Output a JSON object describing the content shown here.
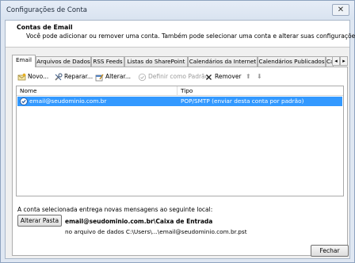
{
  "window": {
    "title": "Configurações de Conta",
    "close_glyph": "✕"
  },
  "header": {
    "title": "Contas de Email",
    "description": "Você pode adicionar ou remover uma conta. Também pode selecionar uma conta e alterar suas configurações."
  },
  "tabs": [
    {
      "label": "Email"
    },
    {
      "label": "Arquivos de Dados"
    },
    {
      "label": "RSS Feeds"
    },
    {
      "label": "Listas do SharePoint"
    },
    {
      "label": "Calendários da Internet"
    },
    {
      "label": "Calendários Publicados"
    },
    {
      "label": "Ca"
    }
  ],
  "tab_scroll": {
    "left": "◂",
    "right": "▸"
  },
  "toolbar": {
    "new": "Novo...",
    "repair": "Reparar...",
    "change": "Alterar...",
    "set_default": "Definir como Padrão",
    "remove": "Remover",
    "move_up": "⬆",
    "move_down": "⬇"
  },
  "accounts_list": {
    "columns": [
      "Nome",
      "Tipo"
    ],
    "rows": [
      {
        "name": "email@seudominio.com.br",
        "type": "POP/SMTP (enviar desta conta por padrão)",
        "default": true
      }
    ]
  },
  "delivery": {
    "label": "A conta selecionada entrega novas mensagens ao seguinte local:",
    "change_folder_button": "Alterar Pasta",
    "folder": "email@seudominio.com.br\\Caixa de Entrada",
    "data_file": "no arquivo de dados C:\\Users\\...\\email@seudominio.com.br.pst"
  },
  "footer": {
    "close_button": "Fechar"
  },
  "colors": {
    "selection": "#3399ff",
    "title_bar": "#dfe7f2"
  }
}
